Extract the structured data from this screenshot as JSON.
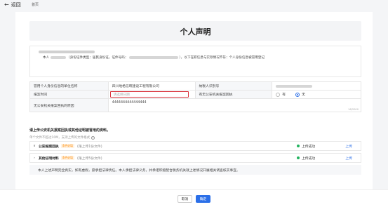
{
  "nav": {
    "back_label": "返回",
    "breadcrumb": "首页"
  },
  "form": {
    "title": "个人声明",
    "statement": {
      "prefix": "本人",
      "id_type_text": "（身份证件类型：居民身份证，证件号码：",
      "suffix": "），以下在职信息与实际情况不符：个人身份信息被冒用登记"
    },
    "fields": {
      "employer_label": "冒用个人身份信息的单位名称",
      "employer_value": "四川地格信筑建设工程有限公司",
      "taxid_label": "纳税人识别号",
      "report_time_label": "报案时间",
      "report_time_placeholder": "请选择日期",
      "police_receipt_label": "有无公安机关报案回执",
      "radio_no": "有",
      "radio_yes": "无",
      "no_receipt_reason_label": "无公安机关报案回执的原因",
      "no_receipt_reason_value": "4444444444444444",
      "counter": "16/2000"
    },
    "upload": {
      "title": "请上传公安机关报案回执或其他证明被冒用的资料。",
      "hint": "单个文件不超过10M，支持上传的文件格式",
      "sections": [
        {
          "name": "公安报案回执",
          "tag": "条件必填",
          "count": "(限上传1份文件)",
          "status": "上传成功",
          "action": "上传"
        },
        {
          "name": "其他证明材料",
          "tag": "条件必填",
          "count": "(限上传5份文件)",
          "status": "上传成功",
          "action": "上传"
        }
      ]
    },
    "pledge": "本人上述声明完全真实，如有虚假，愿承担法律责任。本人承担法律义务，并承诺积极配合税务机关就上述情况开展相关调查核实事宜。"
  },
  "footer": {
    "cancel_label": "取消",
    "confirm_label": "确定"
  },
  "colors": {
    "primary": "#2b6fe8",
    "error_border": "#d9363e",
    "success": "#22b35e",
    "tag": "#ff8a00"
  }
}
